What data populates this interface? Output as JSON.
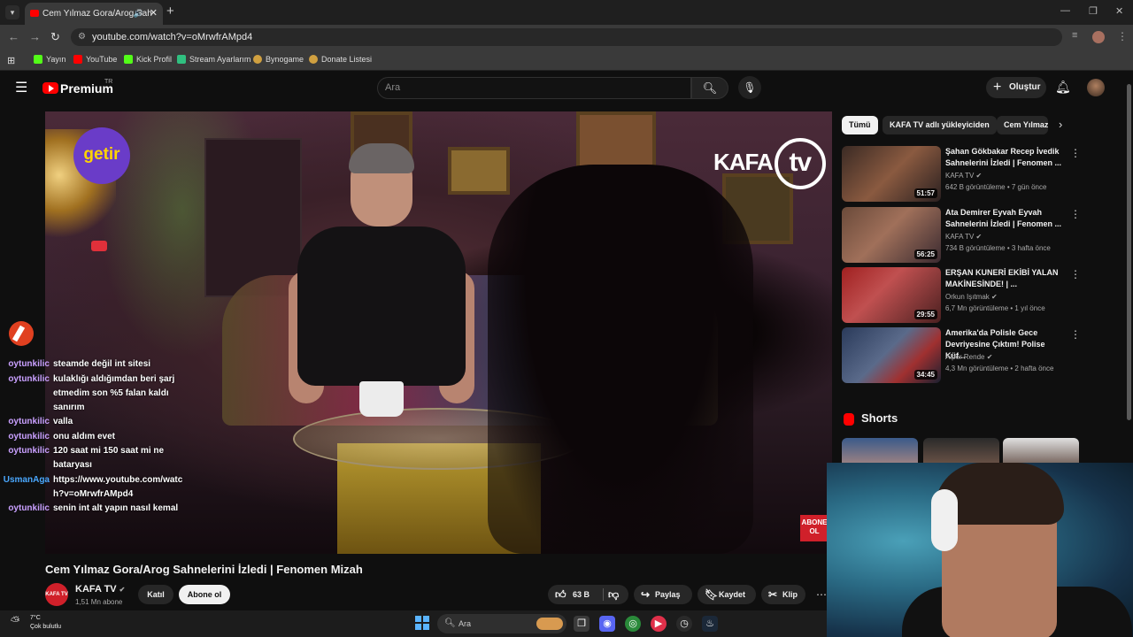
{
  "browser": {
    "tab_title": "Cem Yılmaz Gora/Arog Sah",
    "url": "youtube.com/watch?v=oMrwfrAMpd4",
    "bookmarks": [
      "Yayın",
      "YouTube",
      "Kick Profil",
      "Stream Ayarlarım",
      "Bynogame",
      "Donate Listesi"
    ]
  },
  "youtube": {
    "logo_text": "Premium",
    "region": "TR",
    "search_placeholder": "Ara",
    "create_label": "Oluştur"
  },
  "video": {
    "title": "Cem Yılmaz Gora/Arog Sahnelerini İzledi | Fenomen Mizah",
    "sponsor_text": "getir",
    "watermark_text": "KAFA",
    "watermark_tv": "tv",
    "corner_badge": "ABONE OL",
    "channel": {
      "name": "KAFA TV",
      "subscribers": "1,51 Mn abone",
      "avatar_text": "KAFA TV",
      "join_label": "Katıl",
      "subscribe_label": "Abone ol"
    },
    "actions": {
      "likes": "63 B",
      "share": "Paylaş",
      "save": "Kaydet",
      "clip": "Klip"
    }
  },
  "chat": [
    {
      "user": "oytunkilic",
      "message": "steamde değil int sitesi"
    },
    {
      "user": "oytunkilic",
      "message": "kulaklığı aldığımdan beri şarj etmedim son %5 falan kaldı sanırım"
    },
    {
      "user": "oytunkilic",
      "message": "valla"
    },
    {
      "user": "oytunkilic",
      "message": "onu aldım evet"
    },
    {
      "user": "oytunkilic",
      "message": "120 saat mi 150 saat mi ne bataryası"
    },
    {
      "user": "UsmanAga",
      "message": "https://www.youtube.com/watch?v=oMrwfrAMpd4"
    },
    {
      "user": "oytunkilic",
      "message": "senin int alt yapın nasıl kemal"
    }
  ],
  "sidebar": {
    "chips": [
      "Tümü",
      "KAFA TV adlı yükleyiciden",
      "Cem Yılmaz"
    ],
    "recommendations": [
      {
        "title": "Şahan Gökbakar Recep İvedik Sahnelerini İzledi | Fenomen ...",
        "channel": "KAFA TV",
        "meta": "642 B görüntüleme • 7 gün önce",
        "duration": "51:57"
      },
      {
        "title": "Ata Demirer Eyvah Eyvah Sahnelerini İzledi | Fenomen ...",
        "channel": "KAFA TV",
        "meta": "734 B görüntüleme • 3 hafta önce",
        "duration": "56:25"
      },
      {
        "title": "ERŞAN KUNERİ EKİBİ YALAN MAKİNESİNDE! | ...",
        "channel": "Orkun Işıtmak",
        "meta": "6,7 Mn görüntüleme • 1 yıl önce",
        "duration": "29:55"
      },
      {
        "title": "Amerika'da Polisle Gece Devriyesine Çıktım! Polise Küf...",
        "channel": "Alper Rende",
        "meta": "4,3 Mn görüntüleme • 2 hafta önce",
        "duration": "34:45"
      }
    ],
    "shorts_label": "Shorts"
  },
  "taskbar": {
    "temperature": "7°C",
    "weather": "Çok bulutlu",
    "search_label": "Ara"
  },
  "colors": {
    "yt_red": "#ff0000",
    "bg": "#0f0f0f",
    "chat_user": "#c9a0ff",
    "chat_user_alt": "#4aa8ff"
  }
}
